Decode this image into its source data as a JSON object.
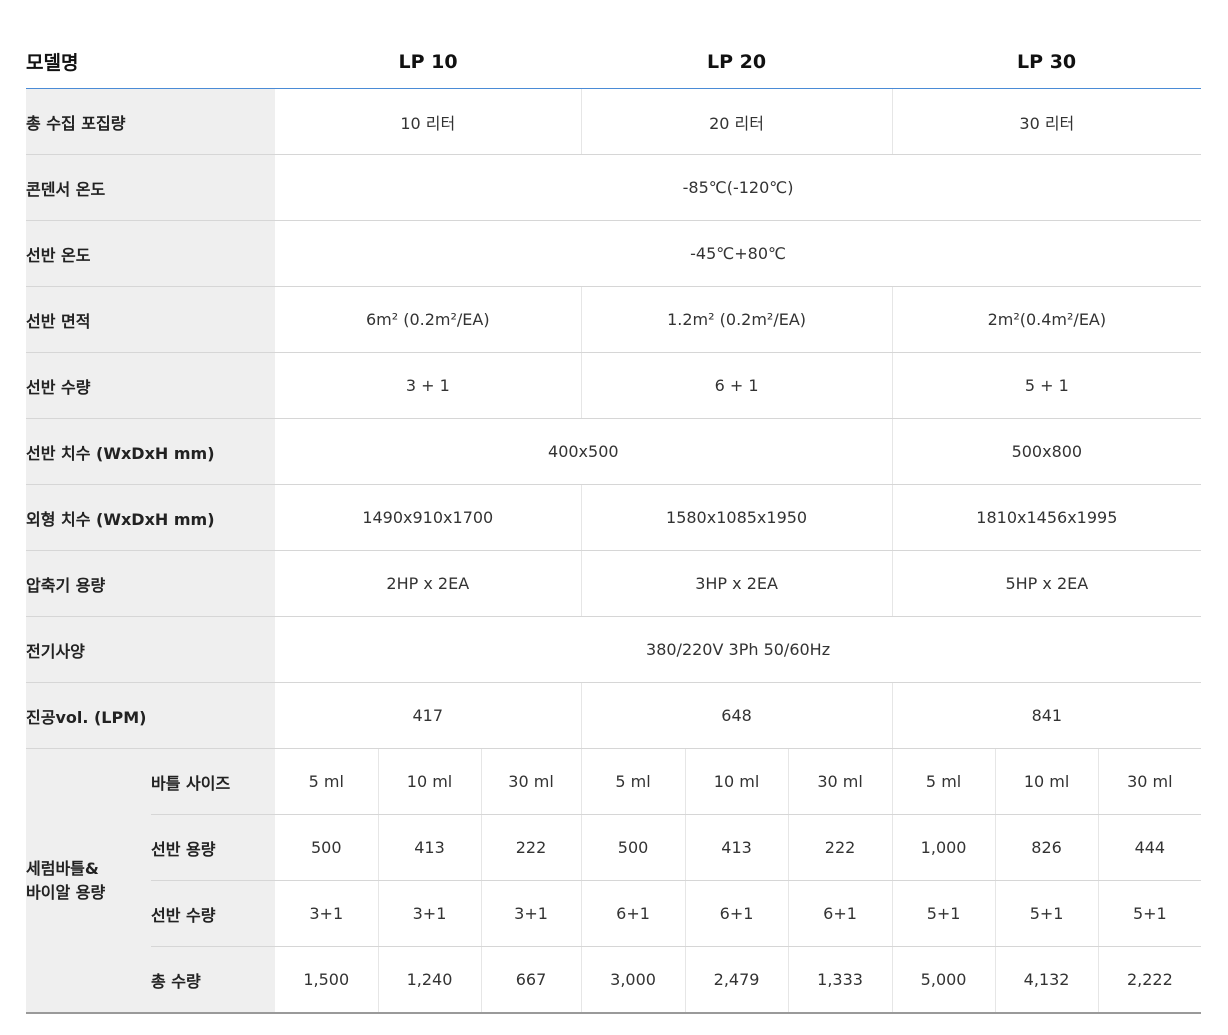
{
  "header": {
    "model_label": "모델명",
    "models": [
      "LP 10",
      "LP 20",
      "LP 30"
    ]
  },
  "rows": {
    "capacity": {
      "label": "총 수집 포집량",
      "values": [
        "10 리터",
        "20 리터",
        "30 리터"
      ]
    },
    "condenser_temp": {
      "label": "콘덴서 온도",
      "value": "-85℃(-120℃)"
    },
    "shelf_temp": {
      "label": "선반 온도",
      "value": "-45℃+80℃"
    },
    "shelf_area": {
      "label": "선반 면적",
      "values": [
        "6m² (0.2m²/EA)",
        "1.2m² (0.2m²/EA)",
        "2m²(0.4m²/EA)"
      ]
    },
    "shelf_count": {
      "label": "선반 수량",
      "values": [
        "3 + 1",
        "6 + 1",
        "5 + 1"
      ]
    },
    "shelf_dims": {
      "label": "선반 치수 (WxDxH mm)",
      "values": [
        "400x500",
        "500x800"
      ]
    },
    "outer_dims": {
      "label": "외형 치수 (WxDxH mm)",
      "values": [
        "1490x910x1700",
        "1580x1085x1950",
        "1810x1456x1995"
      ]
    },
    "compressor": {
      "label": "압축기 용량",
      "values": [
        "2HP x 2EA",
        "3HP x 2EA",
        "5HP x 2EA"
      ]
    },
    "power": {
      "label": "전기사양",
      "value": "380/220V 3Ph 50/60Hz"
    },
    "vacuum": {
      "label": "진공vol. (LPM)",
      "values": [
        "417",
        "648",
        "841"
      ]
    }
  },
  "bottle_group": {
    "label_line1": "세럼바틀&",
    "label_line2": "바이알 용량",
    "rows": [
      {
        "label": "바틀 사이즈",
        "values": [
          "5 ml",
          "10 ml",
          "30 ml",
          "5 ml",
          "10 ml",
          "30 ml",
          "5 ml",
          "10 ml",
          "30 ml"
        ]
      },
      {
        "label": "선반 용량",
        "values": [
          "500",
          "413",
          "222",
          "500",
          "413",
          "222",
          "1,000",
          "826",
          "444"
        ]
      },
      {
        "label": "선반 수량",
        "values": [
          "3+1",
          "3+1",
          "3+1",
          "6+1",
          "6+1",
          "6+1",
          "5+1",
          "5+1",
          "5+1"
        ]
      },
      {
        "label": "총 수량",
        "values": [
          "1,500",
          "1,240",
          "667",
          "3,000",
          "2,479",
          "1,333",
          "5,000",
          "4,132",
          "2,222"
        ]
      }
    ]
  }
}
